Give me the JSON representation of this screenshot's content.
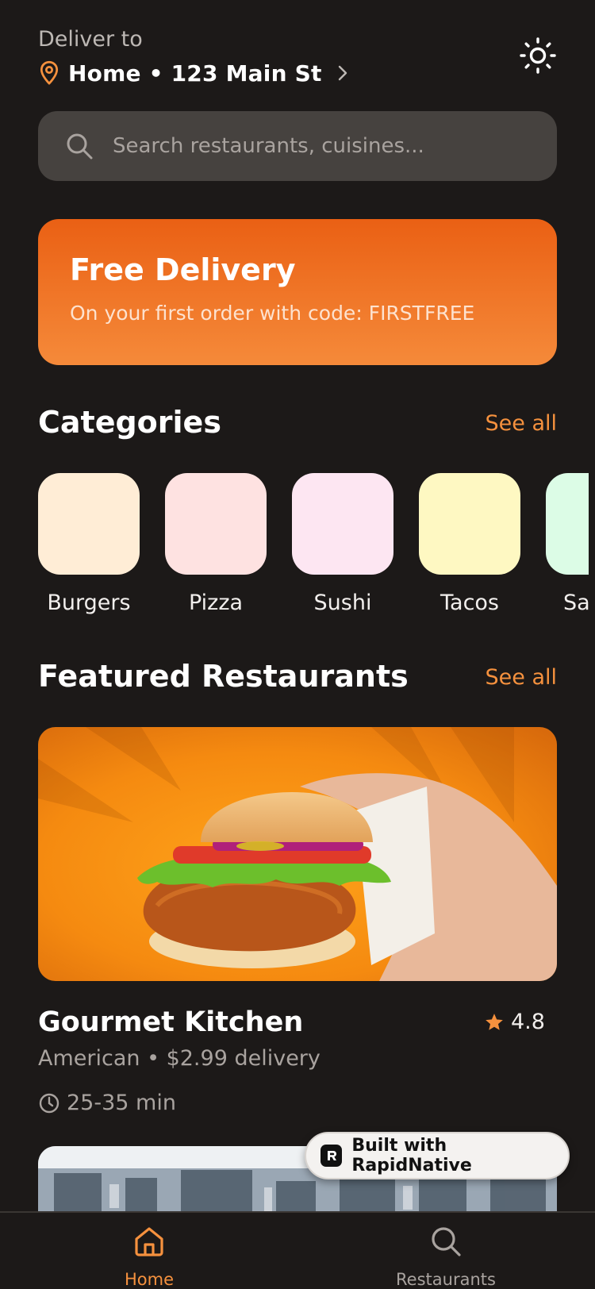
{
  "header": {
    "deliver_label": "Deliver to",
    "address": "Home • 123 Main St",
    "icons": {
      "location": "map-pin-icon",
      "chevron": "chevron-right-icon",
      "theme": "sun-icon"
    }
  },
  "search": {
    "placeholder": "Search restaurants, cuisines..."
  },
  "promo": {
    "title": "Free Delivery",
    "subtitle": "On your first order with code: FIRSTFREE",
    "colors": {
      "start": "#ea6014",
      "end": "#f58a3a"
    }
  },
  "categories": {
    "title": "Categories",
    "see_all": "See all",
    "items": [
      {
        "label": "Burgers",
        "color": "#ffedd6"
      },
      {
        "label": "Pizza",
        "color": "#fee2e1"
      },
      {
        "label": "Sushi",
        "color": "#fde6f2"
      },
      {
        "label": "Tacos",
        "color": "#fef8c2"
      },
      {
        "label": "Salads",
        "color": "#dcfce6"
      }
    ]
  },
  "featured": {
    "title": "Featured Restaurants",
    "see_all": "See all",
    "restaurants": [
      {
        "name": "Gourmet Kitchen",
        "rating": "4.8",
        "meta": "American • $2.99 delivery",
        "time": "25-35 min"
      }
    ]
  },
  "badge": {
    "label": "Built with RapidNative"
  },
  "nav": {
    "items": [
      {
        "label": "Home",
        "icon": "home-icon",
        "active": true
      },
      {
        "label": "Restaurants",
        "icon": "search-icon",
        "active": false
      }
    ]
  },
  "colors": {
    "accent": "#f5913e",
    "background": "#1c1918",
    "surface": "#46423f"
  }
}
